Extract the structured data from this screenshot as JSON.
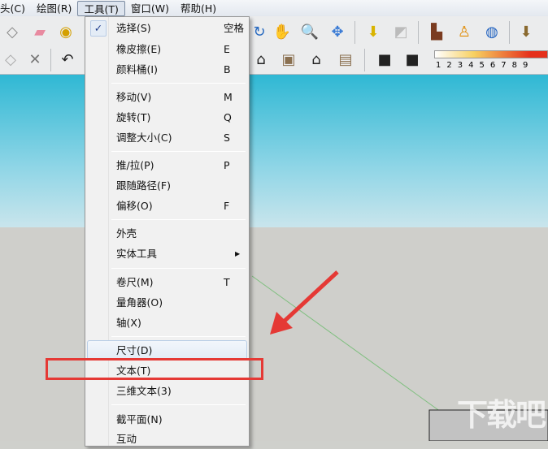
{
  "menubar": [
    "头(C)",
    "绘图(R)",
    "工具(T)",
    "窗口(W)",
    "帮助(H)"
  ],
  "tools_menu": {
    "items": [
      {
        "label": "选择(S)",
        "shortcut": "空格",
        "checked": true
      },
      {
        "label": "橡皮擦(E)",
        "shortcut": "E"
      },
      {
        "label": "颜料桶(I)",
        "shortcut": "B"
      },
      {
        "label": "移动(V)",
        "shortcut": "M"
      },
      {
        "label": "旋转(T)",
        "shortcut": "Q"
      },
      {
        "label": "调整大小(C)",
        "shortcut": "S"
      },
      {
        "label": "推/拉(P)",
        "shortcut": "P"
      },
      {
        "label": "跟随路径(F)",
        "shortcut": ""
      },
      {
        "label": "偏移(O)",
        "shortcut": "F"
      },
      {
        "label": "外壳",
        "shortcut": ""
      },
      {
        "label": "实体工具",
        "shortcut": "",
        "submenu": true
      },
      {
        "label": "卷尺(M)",
        "shortcut": "T"
      },
      {
        "label": "量角器(O)",
        "shortcut": ""
      },
      {
        "label": "轴(X)",
        "shortcut": ""
      },
      {
        "label": "尺寸(D)",
        "shortcut": "",
        "hovered": true
      },
      {
        "label": "文本(T)",
        "shortcut": "",
        "highlighted_by_annotation": true
      },
      {
        "label": "三维文本(3)",
        "shortcut": ""
      },
      {
        "label": "截平面(N)",
        "shortcut": ""
      },
      {
        "label": "互动",
        "shortcut": ""
      }
    ]
  },
  "shadow_scale": [
    "1",
    "2",
    "3",
    "4",
    "5",
    "6",
    "7",
    "8",
    "9"
  ],
  "watermark": "下载吧",
  "colors": {
    "annotation": "#e53935",
    "sky": "#2fb8d4",
    "ground": "#cfcfcb"
  }
}
